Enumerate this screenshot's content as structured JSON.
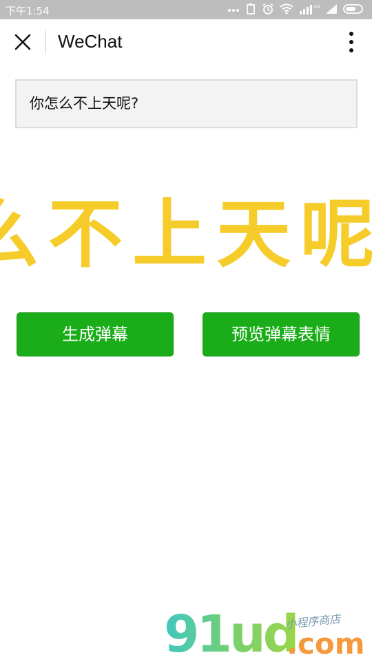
{
  "status_bar": {
    "time": "下午1:54",
    "network_label": "4G"
  },
  "title_bar": {
    "title": "WeChat"
  },
  "input": {
    "value": "你怎么不上天呢?"
  },
  "danmaku": {
    "visible_text": "么不上天呢？",
    "color": "#f5cc2a"
  },
  "buttons": {
    "generate_label": "生成弹幕",
    "preview_label": "预览弹幕表情",
    "color": "#1aad19"
  },
  "watermark": {
    "brand": "91ud",
    "domain": ".com",
    "tagline": "小程序商店"
  },
  "icons": {
    "close": "close-icon",
    "more": "more-vertical-icon"
  }
}
